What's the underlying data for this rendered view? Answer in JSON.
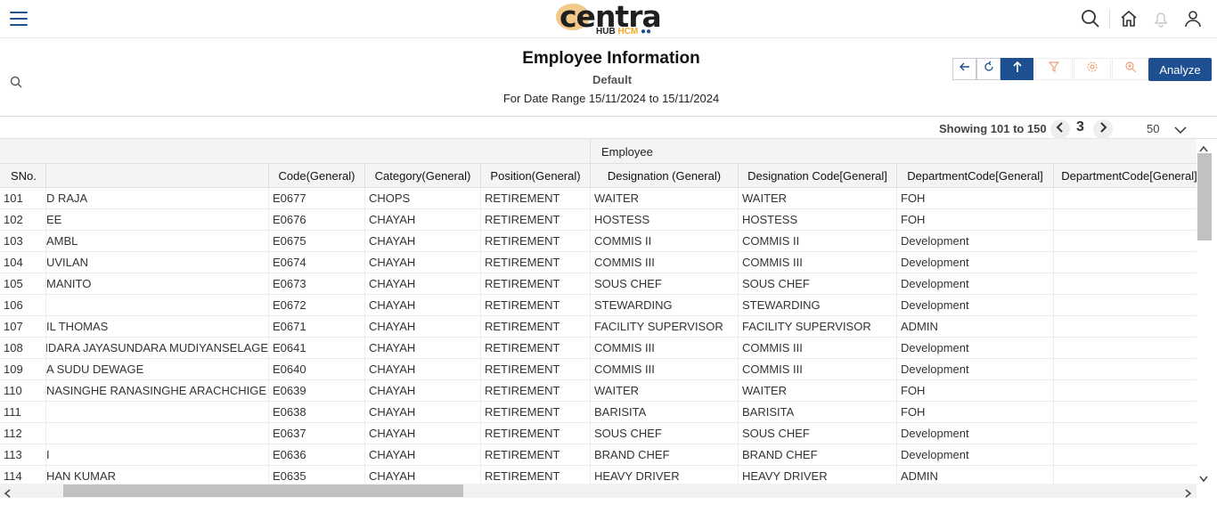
{
  "brand": {
    "name": "centra",
    "sub_a": "HUB",
    "sub_b": "HCM"
  },
  "report": {
    "title": "Employee Information",
    "subtitle": "Default",
    "range": "For Date Range 15/11/2024 to 15/11/2024"
  },
  "toolbar": {
    "analyze_label": "Analyze"
  },
  "pager": {
    "showing": "Showing 101 to 150",
    "page": "3",
    "page_size": "50"
  },
  "grid": {
    "group_label": "Employee",
    "headers": [
      "SNo.",
      "",
      "Code(General)",
      "Category(General)",
      "Position(General)",
      "Designation (General)",
      "Designation Code[General]",
      "DepartmentCode[General]",
      "DepartmentCode[General]"
    ],
    "rows": [
      [
        "101",
        "D RAJA",
        "E0677",
        "CHOPS",
        "RETIREMENT",
        "WAITER",
        "WAITER",
        "FOH",
        ""
      ],
      [
        "102",
        "EE",
        "E0676",
        "CHAYAH",
        "RETIREMENT",
        "HOSTESS",
        "HOSTESS",
        "FOH",
        ""
      ],
      [
        "103",
        "AMBL",
        "E0675",
        "CHAYAH",
        "RETIREMENT",
        "COMMIS II",
        "COMMIS II",
        "Development",
        ""
      ],
      [
        "104",
        "UVILAN",
        "E0674",
        "CHAYAH",
        "RETIREMENT",
        "COMMIS III",
        "COMMIS III",
        "Development",
        ""
      ],
      [
        "105",
        "MANITO",
        "E0673",
        "CHAYAH",
        "RETIREMENT",
        "SOUS CHEF",
        "SOUS CHEF",
        "Development",
        ""
      ],
      [
        "106",
        "",
        "E0672",
        "CHAYAH",
        "RETIREMENT",
        "STEWARDING",
        "STEWARDING",
        "Development",
        ""
      ],
      [
        "107",
        "IL THOMAS",
        "E0671",
        "CHAYAH",
        "RETIREMENT",
        "FACILITY SUPERVISOR",
        "FACILITY SUPERVISOR",
        "ADMIN",
        ""
      ],
      [
        "108",
        "ANDARA JAYASUNDARA MUDIYANSELAGE",
        "E0641",
        "CHAYAH",
        "RETIREMENT",
        "COMMIS III",
        "COMMIS III",
        "Development",
        ""
      ],
      [
        "109",
        "A SUDU DEWAGE",
        "E0640",
        "CHAYAH",
        "RETIREMENT",
        "COMMIS III",
        "COMMIS III",
        "Development",
        ""
      ],
      [
        "110",
        "NASINGHE RANASINGHE ARACHCHIGE",
        "E0639",
        "CHAYAH",
        "RETIREMENT",
        "WAITER",
        "WAITER",
        "FOH",
        ""
      ],
      [
        "111",
        "",
        "E0638",
        "CHAYAH",
        "RETIREMENT",
        "BARISITA",
        "BARISITA",
        "FOH",
        ""
      ],
      [
        "112",
        "",
        "E0637",
        "CHAYAH",
        "RETIREMENT",
        "SOUS CHEF",
        "SOUS CHEF",
        "Development",
        ""
      ],
      [
        "113",
        "I",
        "E0636",
        "CHAYAH",
        "RETIREMENT",
        "BRAND CHEF",
        "BRAND CHEF",
        "Development",
        ""
      ],
      [
        "114",
        "HAN KUMAR",
        "E0635",
        "CHAYAH",
        "RETIREMENT",
        "HEAVY DRIVER",
        "HEAVY DRIVER",
        "ADMIN",
        ""
      ]
    ]
  },
  "colors": {
    "primary": "#1d4f91",
    "accent": "#f5a623",
    "header_bg": "#f4f4f4"
  },
  "icons": [
    "menu-icon",
    "search-icon",
    "home-icon",
    "bell-icon",
    "user-icon",
    "back-arrow-icon",
    "refresh-icon",
    "up-arrow-icon",
    "filter-icon",
    "gear-icon",
    "zoom-icon",
    "chevron-left-icon",
    "chevron-right-icon",
    "chevron-down-icon"
  ]
}
